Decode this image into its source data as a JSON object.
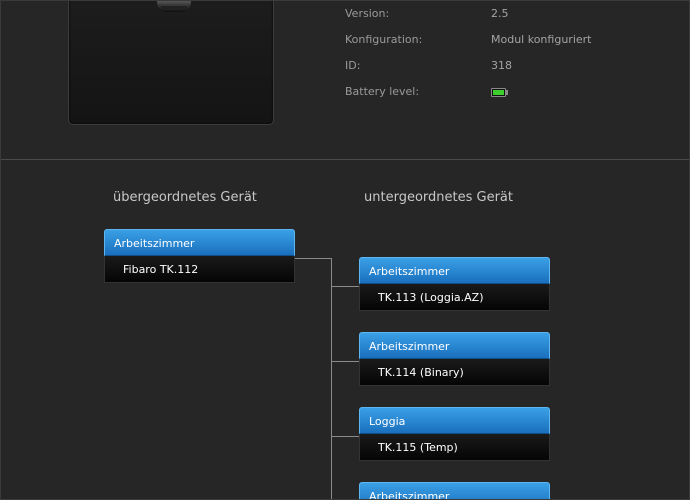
{
  "device_info": {
    "rows": [
      {
        "label": "Version:",
        "value": "2.5"
      },
      {
        "label": "Konfiguration:",
        "value": "Modul konfiguriert"
      },
      {
        "label": "ID:",
        "value": "318"
      },
      {
        "label": "Battery level:",
        "value": ""
      }
    ],
    "battery_icon": "battery-full-icon",
    "battery_color": "#3ccf2e"
  },
  "hierarchy": {
    "parent_heading": "übergeordnetes Gerät",
    "child_heading": "untergeordnetes Gerät",
    "parent": {
      "room": "Arbeitszimmer",
      "device": "Fibaro TK.112"
    },
    "children": [
      {
        "room": "Arbeitszimmer",
        "device": "TK.113 (Loggia.AZ)"
      },
      {
        "room": "Arbeitszimmer",
        "device": "TK.114 (Binary)"
      },
      {
        "room": "Loggia",
        "device": "TK.115 (Temp)"
      },
      {
        "room": "Arbeitszimmer",
        "device": ""
      }
    ],
    "accent_color": "#2a8ad6"
  }
}
